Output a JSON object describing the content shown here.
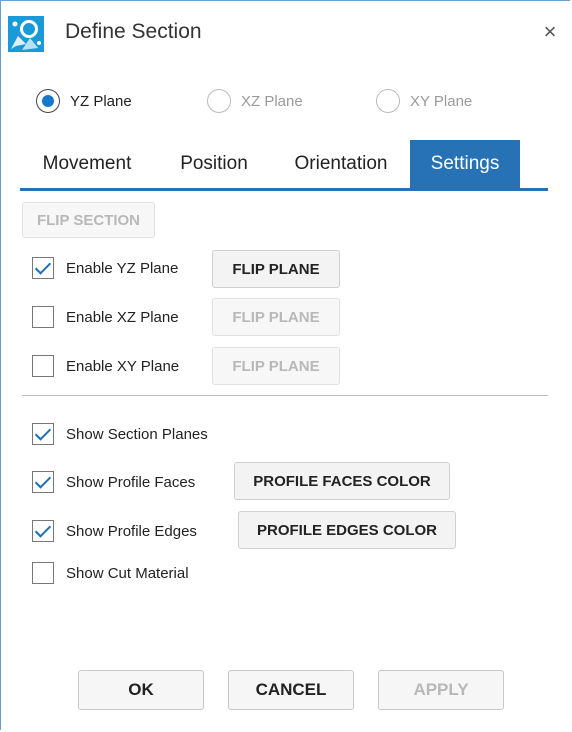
{
  "window": {
    "title": "Define Section",
    "close_glyph": "×"
  },
  "planes": [
    {
      "label": "YZ Plane",
      "selected": true,
      "enabled": true
    },
    {
      "label": "XZ Plane",
      "selected": false,
      "enabled": false
    },
    {
      "label": "XY Plane",
      "selected": false,
      "enabled": false
    }
  ],
  "tabs": [
    {
      "label": "Movement",
      "active": false
    },
    {
      "label": "Position",
      "active": false
    },
    {
      "label": "Orientation",
      "active": false
    },
    {
      "label": "Settings",
      "active": true
    }
  ],
  "settings": {
    "flip_section": "FLIP SECTION",
    "enable_yz": {
      "label": "Enable YZ Plane",
      "checked": true,
      "button": "FLIP PLANE"
    },
    "enable_xz": {
      "label": "Enable XZ Plane",
      "checked": false,
      "button": "FLIP PLANE"
    },
    "enable_xy": {
      "label": "Enable XY Plane",
      "checked": false,
      "button": "FLIP PLANE"
    },
    "show_section_planes": {
      "label": "Show Section Planes",
      "checked": true
    },
    "show_profile_faces": {
      "label": "Show Profile Faces",
      "checked": true,
      "button": "PROFILE FACES COLOR"
    },
    "show_profile_edges": {
      "label": "Show Profile Edges",
      "checked": true,
      "button": "PROFILE EDGES COLOR"
    },
    "show_cut_material": {
      "label": "Show Cut Material",
      "checked": false
    }
  },
  "footer": {
    "ok": "OK",
    "cancel": "CANCEL",
    "apply": "APPLY"
  },
  "colors": {
    "accent": "#2772b4",
    "radio_fill": "#1878c8",
    "check": "#1c6fb8"
  }
}
